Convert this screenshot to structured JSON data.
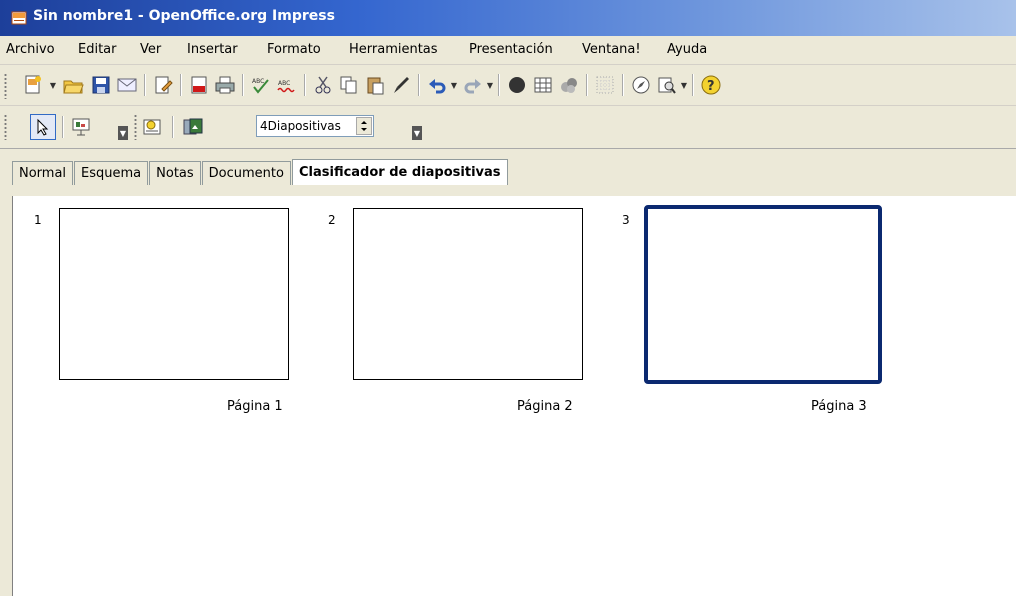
{
  "window": {
    "title": "Sin nombre1 - OpenOffice.org Impress",
    "app_icon": "impress-app-icon"
  },
  "menu": [
    "Archivo",
    "Editar",
    "Ver",
    "Insertar",
    "Formato",
    "Herramientas",
    "Presentación",
    "Ventana!",
    "Ayuda"
  ],
  "toolbar2": {
    "combo_value": "4Diapositivas"
  },
  "tabs": [
    "Normal",
    "Esquema",
    "Notas",
    "Documento",
    "Clasificador de diapositivas"
  ],
  "active_tab": "Clasificador de diapositivas",
  "slides": [
    {
      "number": "1",
      "label": "Página 1",
      "selected": false
    },
    {
      "number": "2",
      "label": "Página 2",
      "selected": false
    },
    {
      "number": "3",
      "label": "Página 3",
      "selected": true
    }
  ],
  "colors": {
    "title_bar": "#1d3f9a",
    "chrome": "#ece9d8",
    "selection": "#0b2970"
  }
}
